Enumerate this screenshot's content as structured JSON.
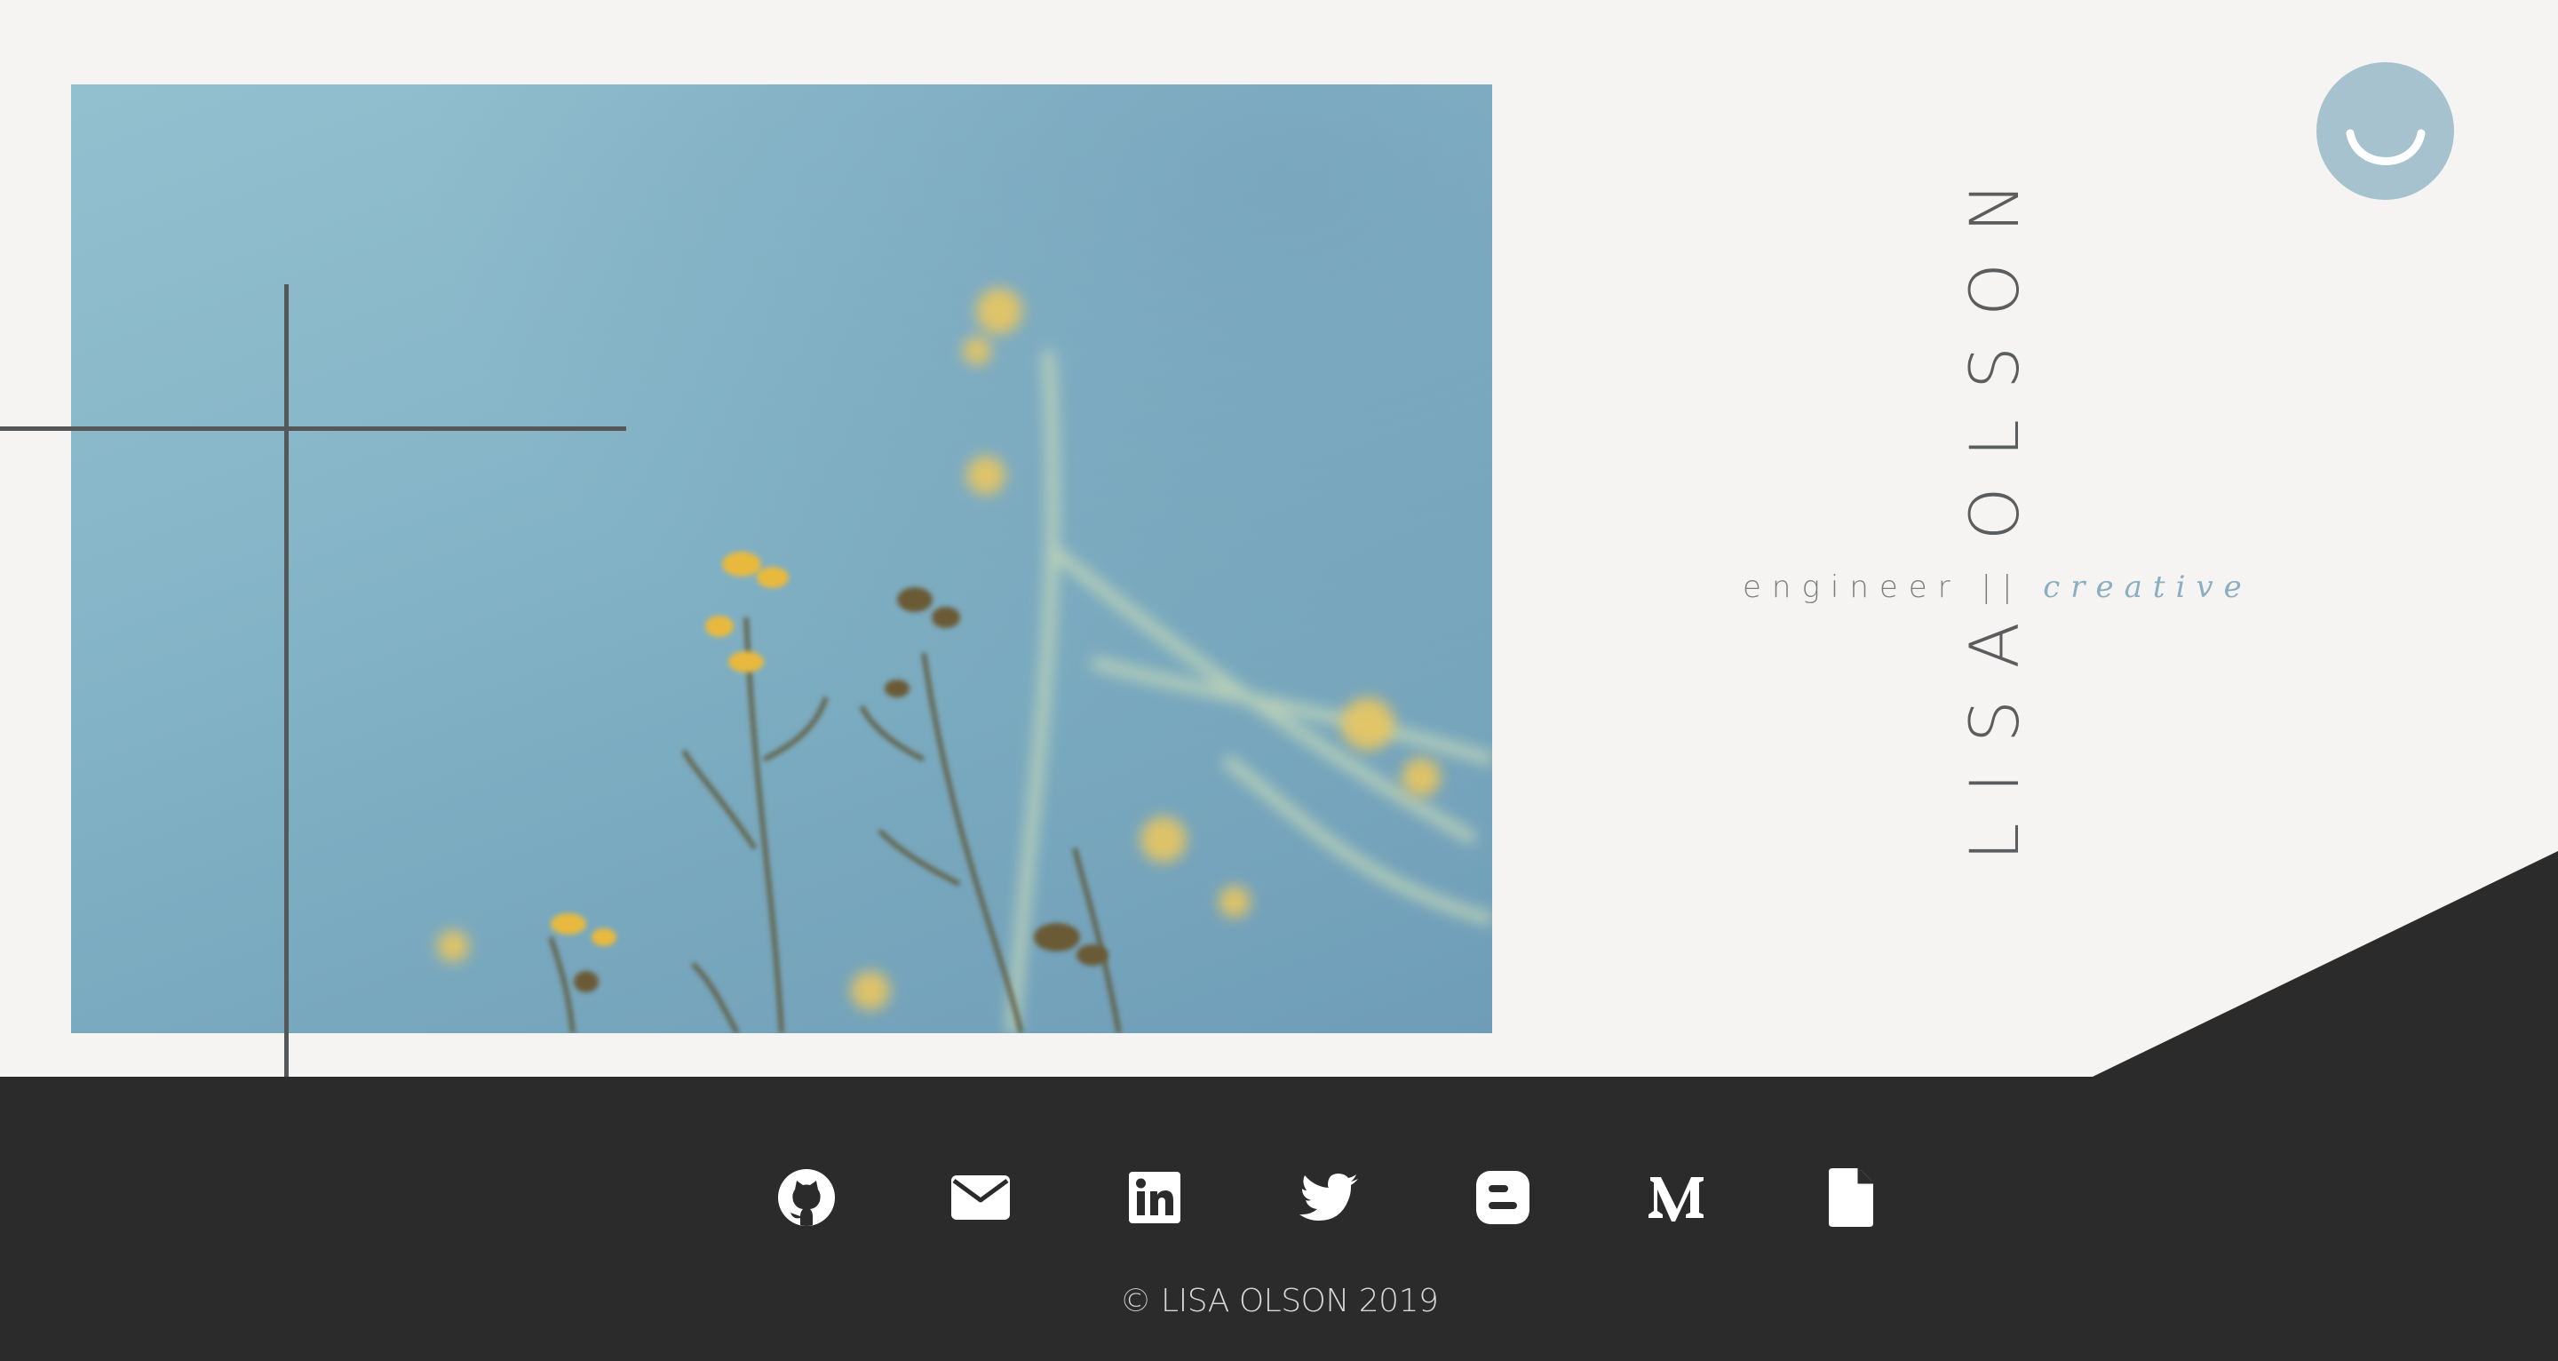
{
  "header": {
    "name": "LISA OLSON",
    "tagline_main": "engineer || ",
    "tagline_accent": "creative"
  },
  "logo": {
    "icon": "smiley-icon"
  },
  "hero": {
    "image": "yellow-flowers-sky-photo"
  },
  "footer": {
    "links": [
      {
        "icon": "github-icon"
      },
      {
        "icon": "mail-icon"
      },
      {
        "icon": "linkedin-icon"
      },
      {
        "icon": "twitter-icon"
      },
      {
        "icon": "blogger-icon"
      },
      {
        "icon": "medium-icon"
      },
      {
        "icon": "document-icon"
      }
    ],
    "copyright": "© LISA OLSON 2019"
  },
  "colors": {
    "background": "#f5f4f2",
    "footer": "#2b2b2b",
    "accent": "#8aaec2",
    "logo": "#a6c2cf",
    "text": "#5a5c5e"
  }
}
